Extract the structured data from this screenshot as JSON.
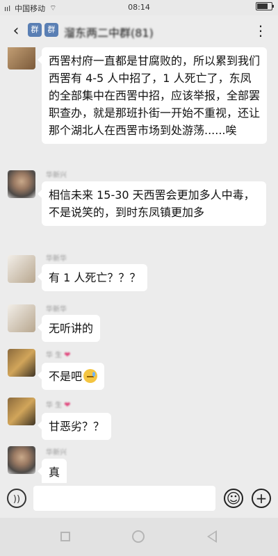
{
  "status_bar": {
    "signal": "ııl",
    "carrier": "中国移动",
    "time": "08:14",
    "battery_level": 0.75
  },
  "header": {
    "title": "溜东两二中群(81)",
    "back_icon": "back-chevron-icon",
    "more_icon": "more-dots-icon"
  },
  "messages": [
    {
      "sender": "",
      "text": "西罟村府一直都是甘腐败的，所以累到我们西罟有 4-5 人中招了，1 人死亡了，东凤的全部集中在西罟中招，应该举报，全部罢职查办，就是那班扑街一开始不重视，还让那个湖北人在西罟市场到处游荡......唉"
    },
    {
      "sender": "华新兴",
      "text": "相信未来 15-30 天西罟会更加多人中毒，不是说笑的，到时东凤镇更加多"
    },
    {
      "sender": "华新华",
      "text": "有 1 人死亡？？？"
    },
    {
      "sender": "华新华",
      "text": "无听讲的"
    },
    {
      "sender": "华 生",
      "text": "不是吧"
    },
    {
      "sender": "华 生",
      "text": "甘恶劣？？"
    },
    {
      "sender": "华新兴",
      "text": "真"
    }
  ],
  "input_bar": {
    "text_value": "",
    "placeholder": "",
    "voice_icon": "voice-icon",
    "emoji_icon": "emoji-icon",
    "plus_icon": "plus-icon"
  },
  "nav_bar": {
    "recent_icon": "recent-apps-icon",
    "home_icon": "home-icon",
    "back_icon": "back-triangle-icon"
  },
  "colors": {
    "background": "#ececec",
    "bubble": "#ffffff",
    "heart": "#e0457b"
  }
}
